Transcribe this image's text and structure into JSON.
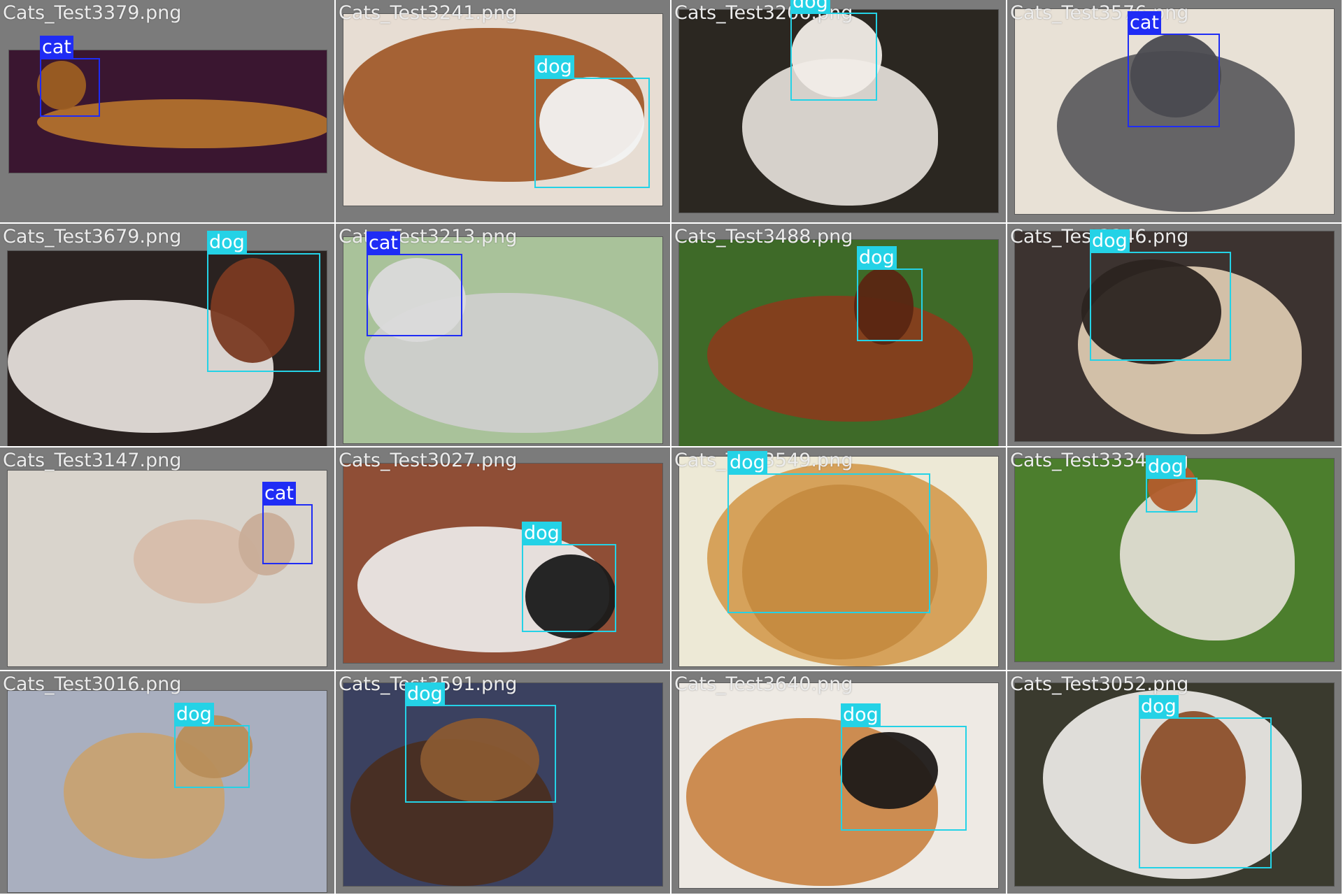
{
  "colors": {
    "cat_box": "#1f2cf5",
    "dog_box": "#24d2e6",
    "cell_background": "#7b7b7b",
    "filename_text": "#ececec"
  },
  "cells": [
    {
      "filename": "Cats_Test3379.png",
      "bg": "#3a1630",
      "subject": "#b8742d",
      "head": "#9c5e22",
      "boxes": [
        {
          "label": "cat",
          "class": "cat"
        }
      ]
    },
    {
      "filename": "Cats_Test3241.png",
      "bg": "#e7ddd3",
      "subject": "#9d5424",
      "head": "#f2f2f2",
      "boxes": [
        {
          "label": "dog",
          "class": "dog"
        }
      ]
    },
    {
      "filename": "Cats_Test3206.png",
      "bg": "#2b2721",
      "subject": "#e9e4de",
      "head": "#f1ece7",
      "boxes": [
        {
          "label": "dog",
          "class": "dog"
        }
      ]
    },
    {
      "filename": "Cats_Test3576.png",
      "bg": "#e8e1d6",
      "subject": "#56565a",
      "head": "#4a4a50",
      "boxes": [
        {
          "label": "cat",
          "class": "cat"
        }
      ]
    },
    {
      "filename": "Cats_Test3679.png",
      "bg": "#2a2220",
      "subject": "#ece7e2",
      "head": "#7a3a22",
      "boxes": [
        {
          "label": "dog",
          "class": "dog"
        }
      ]
    },
    {
      "filename": "Cats_Test3213.png",
      "bg": "#a9c29a",
      "subject": "#cfcfcf",
      "head": "#dadada",
      "boxes": [
        {
          "label": "cat",
          "class": "cat"
        }
      ]
    },
    {
      "filename": "Cats_Test3488.png",
      "bg": "#3e6a28",
      "subject": "#8a3c1c",
      "head": "#5a2612",
      "boxes": [
        {
          "label": "dog",
          "class": "dog"
        }
      ]
    },
    {
      "filename": "Cats_Test3346.png",
      "bg": "#3c3330",
      "subject": "#e2cfb6",
      "head": "#2b2420",
      "boxes": [
        {
          "label": "dog",
          "class": "dog"
        }
      ]
    },
    {
      "filename": "Cats_Test3147.png",
      "bg": "#d9d4cc",
      "subject": "#d6bba8",
      "head": "#c9ad98",
      "boxes": [
        {
          "label": "cat",
          "class": "cat"
        }
      ]
    },
    {
      "filename": "Cats_Test3027.png",
      "bg": "#8f4e36",
      "subject": "#f0efee",
      "head": "#1a1a1a",
      "boxes": [
        {
          "label": "dog",
          "class": "dog"
        }
      ]
    },
    {
      "filename": "Cats_Test3549.png",
      "bg": "#ede9d6",
      "subject": "#d39a4e",
      "head": "#c58b40",
      "boxes": [
        {
          "label": "dog",
          "class": "dog"
        }
      ]
    },
    {
      "filename": "Cats_Test3334.png",
      "bg": "#4c7e2d",
      "subject": "#e8e2da",
      "head": "#b25d2c",
      "boxes": [
        {
          "label": "dog",
          "class": "dog"
        }
      ]
    },
    {
      "filename": "Cats_Test3016.png",
      "bg": "#a9afbf",
      "subject": "#c9a26e",
      "head": "#b88e5a",
      "boxes": [
        {
          "label": "dog",
          "class": "dog"
        }
      ]
    },
    {
      "filename": "Cats_Test3591.png",
      "bg": "#3b4160",
      "subject": "#4a2e1e",
      "head": "#8a5a32",
      "boxes": [
        {
          "label": "dog",
          "class": "dog"
        }
      ]
    },
    {
      "filename": "Cats_Test3640.png",
      "bg": "#eeeae4",
      "subject": "#c88240",
      "head": "#1e1a18",
      "boxes": [
        {
          "label": "dog",
          "class": "dog"
        }
      ]
    },
    {
      "filename": "Cats_Test3052.png",
      "bg": "#3a3a2e",
      "subject": "#f2f0ec",
      "head": "#8c4f2b",
      "boxes": [
        {
          "label": "dog",
          "class": "dog"
        }
      ]
    }
  ]
}
